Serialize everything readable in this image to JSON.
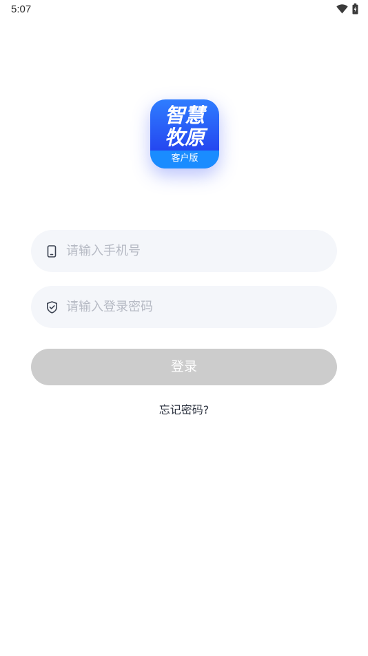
{
  "status_bar": {
    "time": "5:07",
    "icons": [
      "wifi-icon",
      "battery-charging-icon"
    ]
  },
  "logo": {
    "line1": "智慧",
    "line2": "牧原",
    "band": "客户版",
    "colors": {
      "gradient_top": "#2f7dff",
      "gradient_bottom": "#1d39e6",
      "band": "#1a8cff"
    }
  },
  "form": {
    "phone_placeholder": "请输入手机号",
    "phone_value": "",
    "password_placeholder": "请输入登录密码",
    "password_value": "",
    "phone_icon": "mobile-phone-icon",
    "password_icon": "shield-check-icon"
  },
  "login_button": {
    "label": "登录",
    "color": "#cccccc"
  },
  "forgot_link": {
    "label": "忘记密码?"
  }
}
